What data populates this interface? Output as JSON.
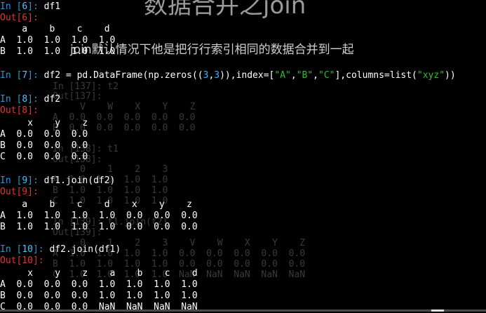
{
  "overlay": {
    "title": "数据合并之join",
    "subtitle": "join默认情况下他是把行行索引相同的数据合并到一起"
  },
  "cells": [
    {
      "in_label": "In [",
      "in_num": "6",
      "in_close": "]: ",
      "code": "df1",
      "out_label": "Out[6]:",
      "output": [
        "    a    b    c    d",
        "A  1.0  1.0  1.0  1.0",
        "B  1.0  1.0  1.0  1.0"
      ]
    },
    {
      "in_label": "In [",
      "in_num": "7",
      "in_close": "]: ",
      "code_parts": [
        "df2 = pd.DataFrame(np.zeros((",
        "3",
        ",",
        "3",
        ")),index=[",
        "\"A\"",
        ",",
        "\"B\"",
        ",",
        "\"C\"",
        "],columns=list(",
        "\"xyz\"",
        "))"
      ]
    },
    {
      "in_label": "In [",
      "in_num": "8",
      "in_close": "]: ",
      "code": "df2",
      "out_label": "Out[8]:",
      "output": [
        "     x    y    z",
        "A  0.0  0.0  0.0",
        "B  0.0  0.0  0.0",
        "C  0.0  0.0  0.0"
      ]
    },
    {
      "in_label": "In [",
      "in_num": "9",
      "in_close": "]: ",
      "code": "df1.join(df2)",
      "out_label": "Out[9]:",
      "output": [
        "    a    b    c    d    x    y    z",
        "A  1.0  1.0  1.0  1.0  0.0  0.0  0.0",
        "B  1.0  1.0  1.0  1.0  0.0  0.0  0.0"
      ]
    },
    {
      "in_label": "In [",
      "in_num": "10",
      "in_close": "]: ",
      "code": "df2.join(df1)",
      "out_label": "Out[10]:",
      "output": [
        "     x    y    z    a    b    c    d",
        "A  0.0  0.0  0.0  1.0  1.0  1.0  1.0",
        "B  0.0  0.0  0.0  1.0  1.0  1.0  1.0",
        "C  0.0  0.0  0.0  NaN  NaN  NaN  NaN"
      ]
    }
  ],
  "ghost": {
    "g1": "In [137]: t2",
    "g2": "Out[137]:",
    "g3": "     V    W    X    Y    Z",
    "g4": "A  0.0  0.0  0.0  0.0  0.0",
    "g5": "B  0.0  0.0  0.0  0.0  0.0",
    "g6": "In [138]: t1",
    "g7": "Out[138]:",
    "g8": "     0    1    2    3",
    "g9": "A  1.0  1.0  1.0  1.0",
    "g10": "B  1.0  1.0  1.0  1.0",
    "g11": "C  1.0  1.0  1.0  1.0",
    "g12": "In [139]: t1.join(t2)",
    "g13": "Out[139]:",
    "g14": "     0    1    2    3    V    W    X    Y    Z",
    "g15": "A  1.0  1.0  1.0  1.0  0.0  0.0  0.0  0.0  0.0",
    "g16": "B  1.0  1.0  1.0  1.0  0.0  0.0  0.0  0.0  0.0",
    "g17": "C  1.0  1.0  1.0  1.0  NaN  NaN  NaN  NaN  NaN"
  }
}
